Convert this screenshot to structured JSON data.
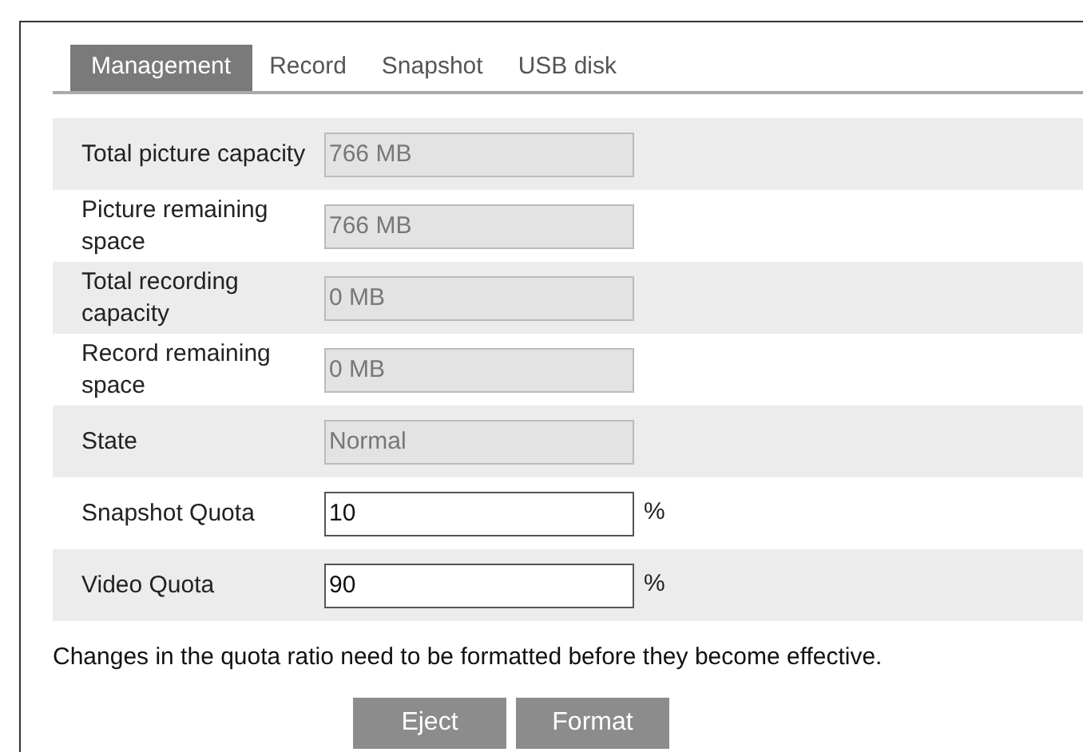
{
  "tabs": [
    {
      "label": "Management",
      "selected": true
    },
    {
      "label": "Record",
      "selected": false
    },
    {
      "label": "Snapshot",
      "selected": false
    },
    {
      "label": "USB disk",
      "selected": false
    }
  ],
  "fields": [
    {
      "label": "Total picture capacity",
      "value": "766 MB",
      "disabled": true
    },
    {
      "label": "Picture remaining space",
      "value": "766 MB",
      "disabled": true
    },
    {
      "label": "Total recording capacity",
      "value": "0 MB",
      "disabled": true
    },
    {
      "label": "Record remaining space",
      "value": "0 MB",
      "disabled": true
    },
    {
      "label": "State",
      "value": "Normal",
      "disabled": true
    },
    {
      "label": "Snapshot Quota",
      "value": "10",
      "disabled": false,
      "unit": "%"
    },
    {
      "label": "Video Quota",
      "value": "90",
      "disabled": false,
      "unit": "%"
    }
  ],
  "note": "Changes in the quota ratio need to be formatted before they become effective.",
  "buttons": [
    "Eject",
    "Format"
  ]
}
